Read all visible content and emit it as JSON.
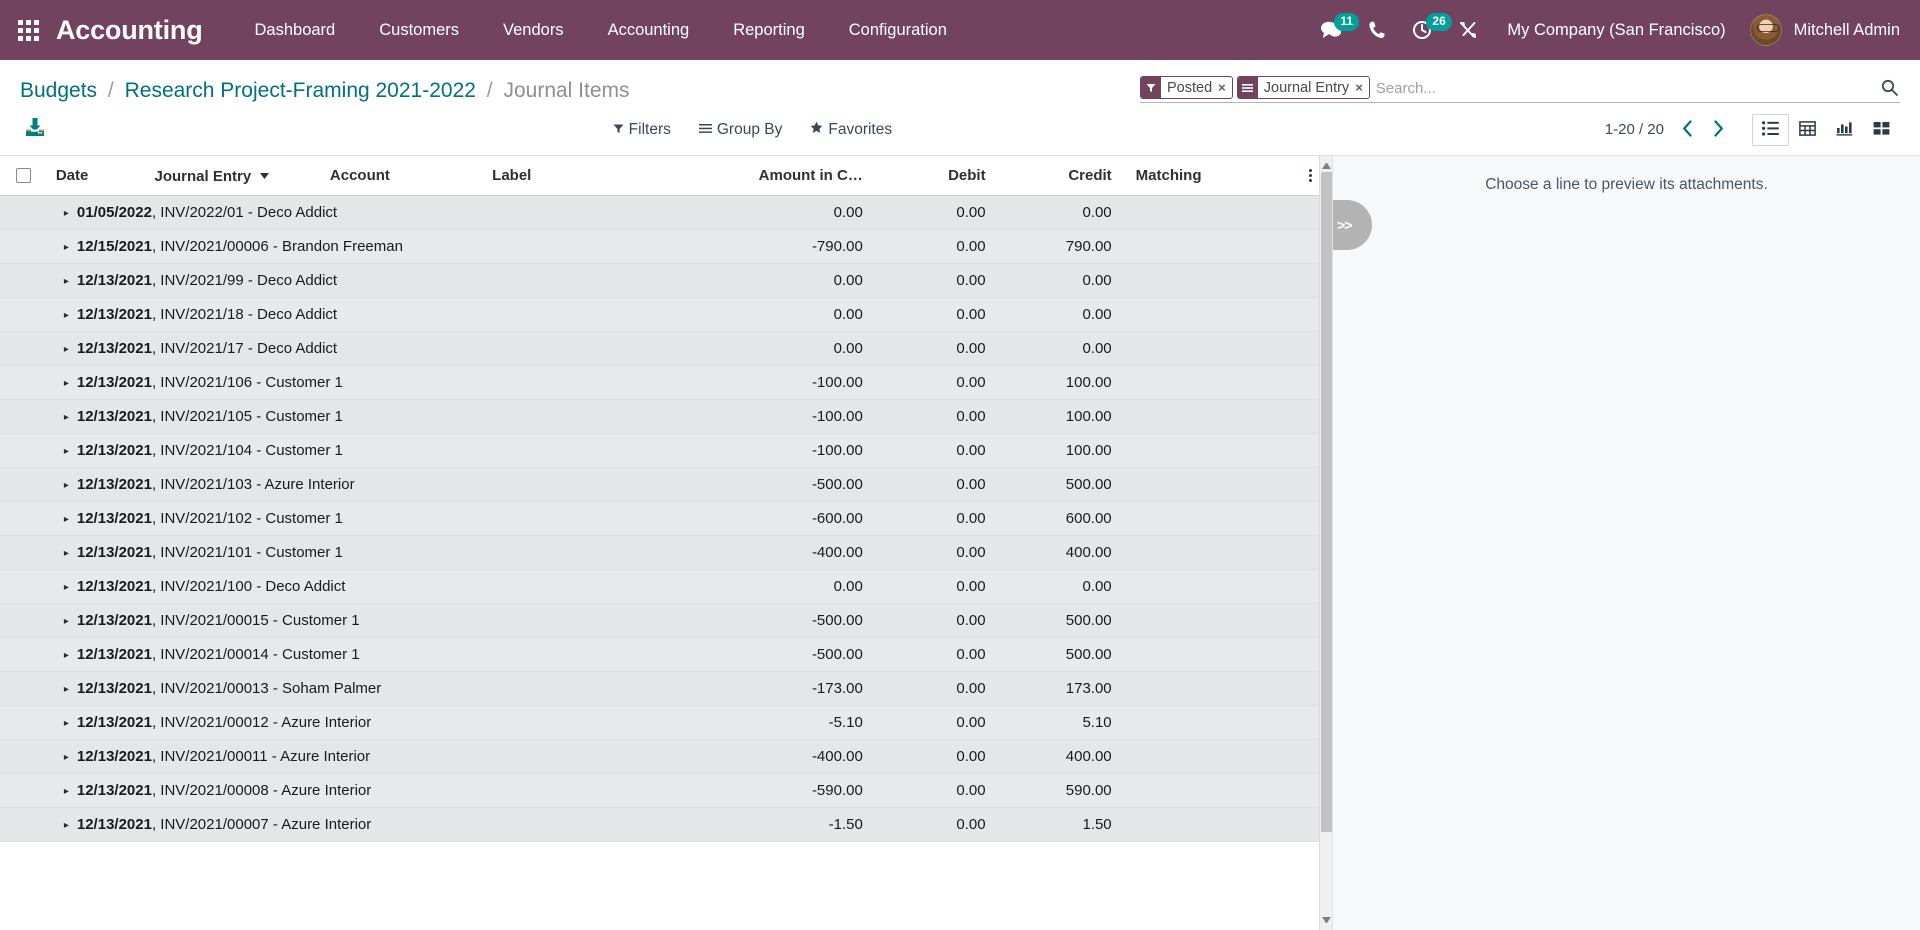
{
  "navbar": {
    "apps_icon": "apps-grid-icon",
    "brand": "Accounting",
    "menus": [
      {
        "label": "Dashboard"
      },
      {
        "label": "Customers"
      },
      {
        "label": "Vendors"
      },
      {
        "label": "Accounting"
      },
      {
        "label": "Reporting"
      },
      {
        "label": "Configuration"
      }
    ],
    "systray": {
      "messages_icon": "chat-bubble-icon",
      "messages_count": "11",
      "phone_icon": "phone-icon",
      "activities_icon": "clock-activity-icon",
      "activities_count": "26",
      "tools_icon": "wrench-screwdriver-icon"
    },
    "company": "My Company (San Francisco)",
    "user": "Mitchell Admin",
    "avatar_icon": "user-avatar",
    "accent_color": "#71435f",
    "badge_color": "#00a09d"
  },
  "breadcrumb": {
    "items": [
      {
        "label": "Budgets",
        "active": false
      },
      {
        "label": "Research Project-Framing 2021-2022",
        "active": false
      },
      {
        "label": "Journal Items",
        "active": true
      }
    ],
    "separator": "/",
    "link_color": "#00707f"
  },
  "search": {
    "facets": [
      {
        "icon": "filter-funnel-icon",
        "label": "Posted",
        "remove": "×"
      },
      {
        "icon": "group-by-lines-icon",
        "label": "Journal Entry",
        "remove": "×"
      }
    ],
    "placeholder": "Search...",
    "value": "",
    "search_icon": "search-magnifier-icon"
  },
  "toolbar": {
    "export_icon": "download-export-icon",
    "filters_label": "Filters",
    "filters_icon": "filter-funnel-icon",
    "groupby_label": "Group By",
    "groupby_icon": "group-by-lines-icon",
    "favorites_label": "Favorites",
    "favorites_icon": "star-icon"
  },
  "pager": {
    "range": "1-20 / 20",
    "prev_icon": "chevron-left-icon",
    "next_icon": "chevron-right-icon"
  },
  "views": [
    {
      "name": "list",
      "icon": "list-view-icon",
      "active": true
    },
    {
      "name": "pivot",
      "icon": "pivot-table-icon",
      "active": false
    },
    {
      "name": "graph",
      "icon": "bar-chart-icon",
      "active": false
    },
    {
      "name": "kanban",
      "icon": "kanban-view-icon",
      "active": false
    }
  ],
  "table": {
    "columns": [
      {
        "key": "select",
        "label": "",
        "align": "left"
      },
      {
        "key": "date",
        "label": "Date",
        "align": "left"
      },
      {
        "key": "entry",
        "label": "Journal Entry",
        "align": "left",
        "sorted": "desc"
      },
      {
        "key": "account",
        "label": "Account",
        "align": "left"
      },
      {
        "key": "label",
        "label": "Label",
        "align": "left"
      },
      {
        "key": "amount",
        "label": "Amount in C…",
        "align": "right"
      },
      {
        "key": "debit",
        "label": "Debit",
        "align": "right"
      },
      {
        "key": "credit",
        "label": "Credit",
        "align": "right"
      },
      {
        "key": "matching",
        "label": "Matching",
        "align": "left"
      },
      {
        "key": "options",
        "label": "",
        "align": "center"
      }
    ],
    "optional_columns_icon": "vertical-dots-icon",
    "group_caret_icon": "caret-right-icon",
    "rows": [
      {
        "caret": "▸",
        "date": "01/05/2022",
        "entry": "INV/2022/01 - Deco Addict",
        "account": "",
        "label": "",
        "amount": "0.00",
        "debit": "0.00",
        "credit": "0.00",
        "matching": ""
      },
      {
        "caret": "▸",
        "date": "12/15/2021",
        "entry": "INV/2021/00006 - Brandon Freeman",
        "account": "",
        "label": "",
        "amount": "-790.00",
        "debit": "0.00",
        "credit": "790.00",
        "matching": ""
      },
      {
        "caret": "▸",
        "date": "12/13/2021",
        "entry": "INV/2021/99 - Deco Addict",
        "account": "",
        "label": "",
        "amount": "0.00",
        "debit": "0.00",
        "credit": "0.00",
        "matching": ""
      },
      {
        "caret": "▸",
        "date": "12/13/2021",
        "entry": "INV/2021/18 - Deco Addict",
        "account": "",
        "label": "",
        "amount": "0.00",
        "debit": "0.00",
        "credit": "0.00",
        "matching": ""
      },
      {
        "caret": "▸",
        "date": "12/13/2021",
        "entry": "INV/2021/17 - Deco Addict",
        "account": "",
        "label": "",
        "amount": "0.00",
        "debit": "0.00",
        "credit": "0.00",
        "matching": ""
      },
      {
        "caret": "▸",
        "date": "12/13/2021",
        "entry": "INV/2021/106 - Customer 1",
        "account": "",
        "label": "",
        "amount": "-100.00",
        "debit": "0.00",
        "credit": "100.00",
        "matching": ""
      },
      {
        "caret": "▸",
        "date": "12/13/2021",
        "entry": "INV/2021/105 - Customer 1",
        "account": "",
        "label": "",
        "amount": "-100.00",
        "debit": "0.00",
        "credit": "100.00",
        "matching": ""
      },
      {
        "caret": "▸",
        "date": "12/13/2021",
        "entry": "INV/2021/104 - Customer 1",
        "account": "",
        "label": "",
        "amount": "-100.00",
        "debit": "0.00",
        "credit": "100.00",
        "matching": ""
      },
      {
        "caret": "▸",
        "date": "12/13/2021",
        "entry": "INV/2021/103 - Azure Interior",
        "account": "",
        "label": "",
        "amount": "-500.00",
        "debit": "0.00",
        "credit": "500.00",
        "matching": ""
      },
      {
        "caret": "▸",
        "date": "12/13/2021",
        "entry": "INV/2021/102 - Customer 1",
        "account": "",
        "label": "",
        "amount": "-600.00",
        "debit": "0.00",
        "credit": "600.00",
        "matching": ""
      },
      {
        "caret": "▸",
        "date": "12/13/2021",
        "entry": "INV/2021/101 - Customer 1",
        "account": "",
        "label": "",
        "amount": "-400.00",
        "debit": "0.00",
        "credit": "400.00",
        "matching": ""
      },
      {
        "caret": "▸",
        "date": "12/13/2021",
        "entry": "INV/2021/100 - Deco Addict",
        "account": "",
        "label": "",
        "amount": "0.00",
        "debit": "0.00",
        "credit": "0.00",
        "matching": ""
      },
      {
        "caret": "▸",
        "date": "12/13/2021",
        "entry": "INV/2021/00015 - Customer 1",
        "account": "",
        "label": "",
        "amount": "-500.00",
        "debit": "0.00",
        "credit": "500.00",
        "matching": ""
      },
      {
        "caret": "▸",
        "date": "12/13/2021",
        "entry": "INV/2021/00014 - Customer 1",
        "account": "",
        "label": "",
        "amount": "-500.00",
        "debit": "0.00",
        "credit": "500.00",
        "matching": ""
      },
      {
        "caret": "▸",
        "date": "12/13/2021",
        "entry": "INV/2021/00013 - Soham Palmer",
        "account": "",
        "label": "",
        "amount": "-173.00",
        "debit": "0.00",
        "credit": "173.00",
        "matching": ""
      },
      {
        "caret": "▸",
        "date": "12/13/2021",
        "entry": "INV/2021/00012 - Azure Interior",
        "account": "",
        "label": "",
        "amount": "-5.10",
        "debit": "0.00",
        "credit": "5.10",
        "matching": ""
      },
      {
        "caret": "▸",
        "date": "12/13/2021",
        "entry": "INV/2021/00011 - Azure Interior",
        "account": "",
        "label": "",
        "amount": "-400.00",
        "debit": "0.00",
        "credit": "400.00",
        "matching": ""
      },
      {
        "caret": "▸",
        "date": "12/13/2021",
        "entry": "INV/2021/00008 - Azure Interior",
        "account": "",
        "label": "",
        "amount": "-590.00",
        "debit": "0.00",
        "credit": "590.00",
        "matching": ""
      },
      {
        "caret": "▸",
        "date": "12/13/2021",
        "entry": "INV/2021/00007 - Azure Interior",
        "account": "",
        "label": "",
        "amount": "-1.50",
        "debit": "0.00",
        "credit": "1.50",
        "matching": ""
      }
    ]
  },
  "preview": {
    "message": "Choose a line to preview its attachments.",
    "collapse_label": ">>",
    "collapse_icon": "double-chevron-right-icon"
  }
}
